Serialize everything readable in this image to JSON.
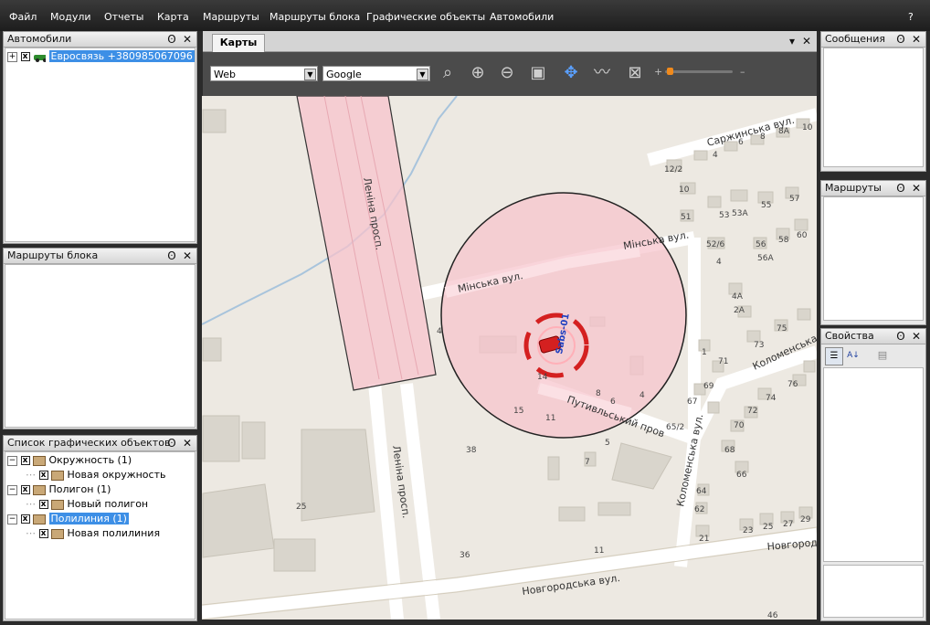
{
  "menu": [
    "Файл",
    "Модули",
    "Отчеты",
    "Карта",
    "Маршруты",
    "Маршруты блока",
    "Графические объекты",
    "Автомобили"
  ],
  "help_label": "?",
  "panels": {
    "vehicles": {
      "title": "Автомобили",
      "items": [
        {
          "label": "Евросвязь +380985067096"
        }
      ]
    },
    "block_routes": {
      "title": "Маршруты блока"
    },
    "graphic_objects": {
      "title": "Список графических объектов",
      "items": [
        {
          "label": "Окружность (1)",
          "child": "Новая окружность"
        },
        {
          "label": "Полигон (1)",
          "child": "Новый полигон"
        },
        {
          "label": "Полилиния (1)",
          "child": "Новая полилиния"
        }
      ]
    },
    "messages": {
      "title": "Сообщения"
    },
    "routes": {
      "title": "Маршруты"
    },
    "properties": {
      "title": "Свойства"
    }
  },
  "map": {
    "tab": "Карты",
    "map_type": "Web",
    "provider": "Google",
    "vehicle_label": "Sabs-01",
    "streets": {
      "lenina_top": "Леніна просп.",
      "lenina_bottom": "Леніна просп.",
      "minska1": "Мінська вул.",
      "minska2": "Мінська вул.",
      "putyvl": "Путивльський пров",
      "kolomen1": "Коломенська",
      "kolomen2": "Коломенська вул.",
      "novgorod1": "Новгородська вул.",
      "novgorod2": "Новгород",
      "sarzhyn": "Саржинська вул."
    },
    "numbers": {
      "n1": "12/2",
      "n2": "10",
      "n3": "51",
      "n4": "53",
      "n5": "53А",
      "n6": "55",
      "n7": "57",
      "n8": "4",
      "n9": "6",
      "n10": "8",
      "n11": "8А",
      "n12": "10",
      "n13": "52/6",
      "n14": "56",
      "n15": "56А",
      "n16": "58",
      "n17": "60",
      "n18": "4",
      "n19": "4А",
      "n20": "2А",
      "n21": "75",
      "n22": "73",
      "n23": "1",
      "n24": "71",
      "n25": "69",
      "n26": "67",
      "n27": "74",
      "n28": "76",
      "n29": "72",
      "n30": "70",
      "n31": "68",
      "n32": "66",
      "n33": "64",
      "n34": "62",
      "n35": "21",
      "n36": "23",
      "n37": "25",
      "n38": "27",
      "n39": "29",
      "n40": "65/2",
      "n41": "5",
      "n42": "7",
      "n43": "38",
      "n44": "25",
      "n45": "36",
      "n46": "11",
      "n47": "46",
      "n48": "15",
      "n49": "11",
      "n50": "6",
      "n51": "8",
      "n52": "4",
      "n53": "14",
      "n54": "46",
      "n55": "4"
    },
    "zoom_minus": "–",
    "zoom_plus": "+"
  },
  "colors": {
    "accent": "#3d8fe6",
    "zone_fill": "#f7c3cc",
    "vehicle": "#d42020"
  }
}
